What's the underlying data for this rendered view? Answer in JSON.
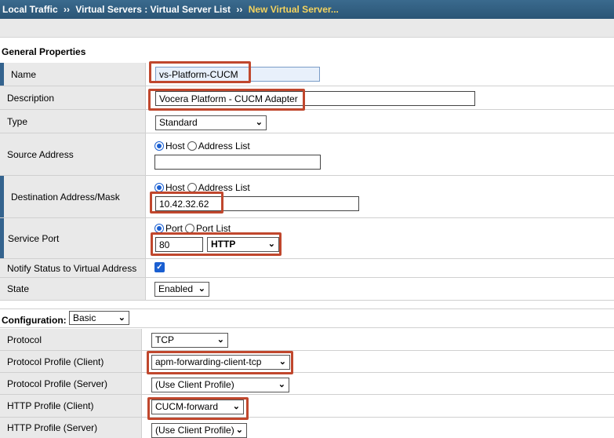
{
  "breadcrumb": {
    "part1": "Local Traffic",
    "sep": "››",
    "part2": "Virtual Servers : Virtual Server List",
    "current": "New Virtual Server..."
  },
  "general": {
    "heading": "General Properties",
    "name_label": "Name",
    "name_value": "vs-Platform-CUCM",
    "description_label": "Description",
    "description_value": "Vocera Platform - CUCM Adapter",
    "type_label": "Type",
    "type_value": "Standard",
    "source_label": "Source Address",
    "source_host": "Host",
    "source_list": "Address List",
    "source_value": "",
    "dest_label": "Destination Address/Mask",
    "dest_host": "Host",
    "dest_list": "Address List",
    "dest_value": "10.42.32.62",
    "port_label": "Service Port",
    "port_opt": "Port",
    "port_list": "Port List",
    "port_value": "80",
    "port_service": "HTTP",
    "notify_label": "Notify Status to Virtual Address",
    "notify_checked": true,
    "state_label": "State",
    "state_value": "Enabled"
  },
  "configuration": {
    "label": "Configuration:",
    "mode": "Basic",
    "protocol_label": "Protocol",
    "protocol_value": "TCP",
    "ppc_label": "Protocol Profile (Client)",
    "ppc_value": "apm-forwarding-client-tcp",
    "pps_label": "Protocol Profile (Server)",
    "pps_value": "(Use Client Profile)",
    "httpc_label": "HTTP Profile (Client)",
    "httpc_value": "CUCM-forward",
    "https_label": "HTTP Profile (Server)",
    "https_value": "(Use Client Profile)"
  },
  "colors": {
    "highlight": "#c0472d",
    "required_bar": "#34638e",
    "title_bg": "#2b5576",
    "breadcrumb_current": "#f4d35e"
  }
}
